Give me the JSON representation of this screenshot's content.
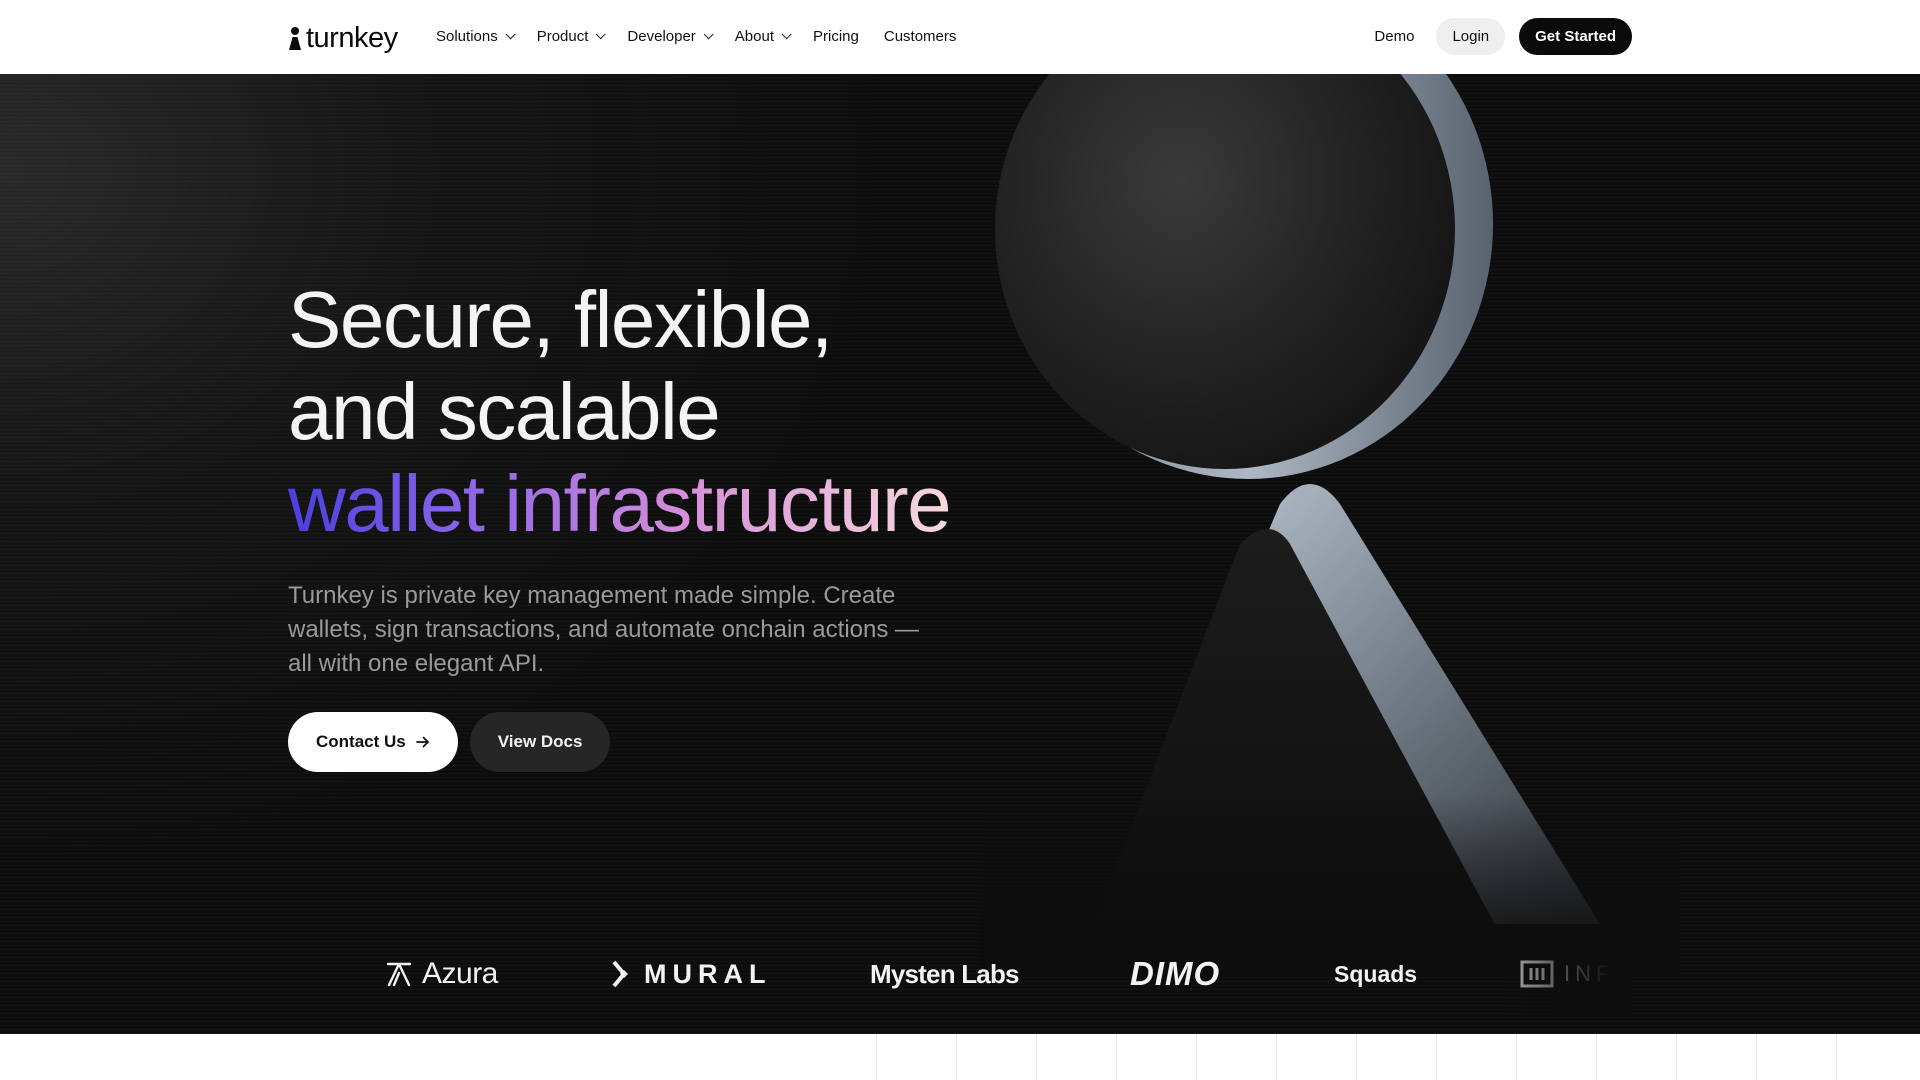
{
  "nav": {
    "brand": "turnkey",
    "menu": [
      {
        "label": "Solutions",
        "has_dropdown": true
      },
      {
        "label": "Product",
        "has_dropdown": true
      },
      {
        "label": "Developer",
        "has_dropdown": true
      },
      {
        "label": "About",
        "has_dropdown": true
      },
      {
        "label": "Pricing",
        "has_dropdown": false
      },
      {
        "label": "Customers",
        "has_dropdown": false
      }
    ],
    "demo_label": "Demo",
    "login_label": "Login",
    "get_started_label": "Get Started"
  },
  "hero": {
    "headline_line1": "Secure, flexible,",
    "headline_line2": "and scalable",
    "headline_accent": "wallet infrastructure",
    "subtext": "Turnkey is private key management made simple. Create wallets, sign transactions, and automate onchain actions — all with one elegant API.",
    "contact_label": "Contact Us",
    "docs_label": "View Docs"
  },
  "logos": {
    "azura": "Azura",
    "mural": "MURAL",
    "mysten": "Mysten Labs",
    "dimo": "DIMO",
    "squads": "Squads",
    "infinex": "INFINEX"
  },
  "colors": {
    "accent_gradient_start": "#4a3fe0",
    "accent_gradient_mid": "#d68fd8",
    "accent_gradient_end": "#f6d9dc",
    "hero_background": "#0d0d0d",
    "primary_button": "#0b0b0b"
  }
}
